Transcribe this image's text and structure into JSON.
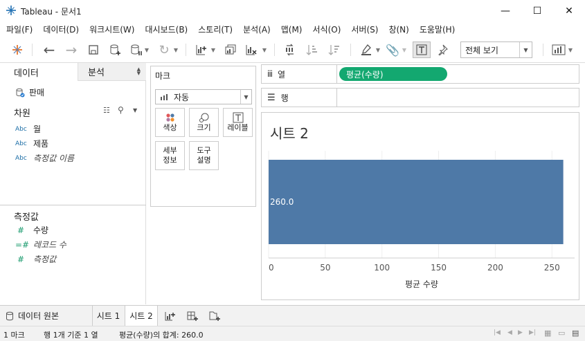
{
  "window": {
    "title": "Tableau - 문서1",
    "minimize": "—",
    "maximize": "☐",
    "close": "✕"
  },
  "menu": [
    "파일(F)",
    "데이터(D)",
    "워크시트(W)",
    "대시보드(B)",
    "스토리(T)",
    "분석(A)",
    "맵(M)",
    "서식(O)",
    "서버(S)",
    "창(N)",
    "도움말(H)"
  ],
  "toolbar": {
    "view_select": "전체 보기"
  },
  "left_panel": {
    "tab_data": "데이터",
    "tab_analysis": "분석",
    "datasource": "판매",
    "dimensions_header": "차원",
    "dimensions": [
      {
        "type": "Abc",
        "name": "월",
        "italic": false
      },
      {
        "type": "Abc",
        "name": "제품",
        "italic": false
      },
      {
        "type": "Abc",
        "name": "측정값 이름",
        "italic": true
      }
    ],
    "measures_header": "측정값",
    "measures": [
      {
        "type": "#",
        "name": "수량",
        "italic": false
      },
      {
        "type": "=#",
        "name": "레코드 수",
        "italic": true
      },
      {
        "type": "#",
        "name": "측정값",
        "italic": true
      }
    ]
  },
  "marks": {
    "header": "마크",
    "mark_type": "자동",
    "buttons": {
      "color": "색상",
      "size": "크기",
      "label": "레이블",
      "detail1": "세부",
      "detail2": "정보",
      "tooltip1": "도구",
      "tooltip2": "설명"
    }
  },
  "shelves": {
    "columns_label": "열",
    "rows_label": "행",
    "columns_pill": "평균(수량)"
  },
  "view": {
    "sheet_title": "시트 2"
  },
  "chart_data": {
    "type": "bar",
    "orientation": "horizontal",
    "values": [
      260.0
    ],
    "data_labels": [
      "260.0"
    ],
    "xlabel": "평균 수량",
    "xlim": [
      0,
      270
    ],
    "xticks": [
      0,
      50,
      100,
      150,
      200,
      250
    ],
    "bar_color": "#4e79a7"
  },
  "sheet_tabs": {
    "datasource": "데이터 원본",
    "sheet1": "시트 1",
    "sheet2": "시트 2"
  },
  "status": {
    "marks": "1 마크",
    "rows_cols": "행 1개 기준 1 열",
    "sum": "평균(수량)의 합계: 260.0"
  }
}
